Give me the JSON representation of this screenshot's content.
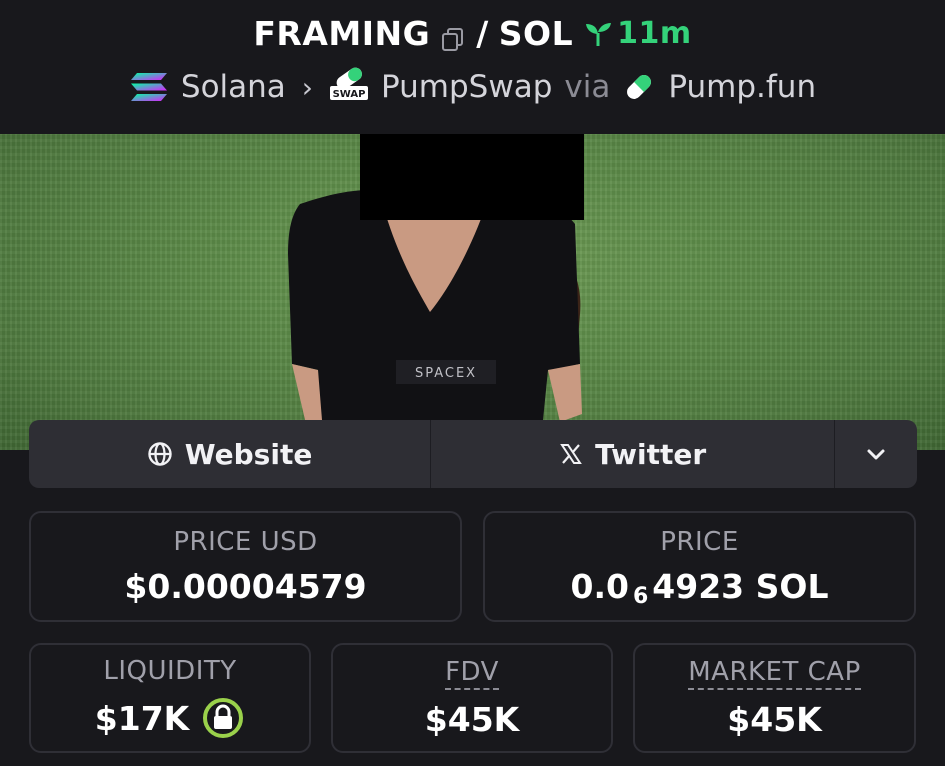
{
  "header": {
    "token": "FRAMING",
    "separator": "/",
    "quote": "SOL",
    "age": "11m",
    "chain": "Solana",
    "dex": "PumpSwap",
    "dex_badge": "SWAP",
    "via": "via",
    "launchpad": "Pump.fun"
  },
  "links": {
    "website": "Website",
    "twitter": "Twitter"
  },
  "stats": {
    "price_usd": {
      "label": "PRICE USD",
      "value": "$0.00004579"
    },
    "price": {
      "label": "PRICE",
      "prefix": "0.0",
      "zeros": "6",
      "suffix": "4923 SOL"
    },
    "liquidity": {
      "label": "LIQUIDITY",
      "value": "$17K"
    },
    "fdv": {
      "label": "FDV",
      "value": "$45K"
    },
    "market_cap": {
      "label": "MARKET CAP",
      "value": "$45K"
    }
  },
  "banner": {
    "shirt_text": "SPACEX"
  },
  "colors": {
    "accent_green": "#34d27a",
    "lock_green": "#9ad14b",
    "background": "#18181c",
    "card_border": "#2f2f36"
  },
  "icons": [
    "copy-icon",
    "sprout-icon",
    "solana-icon",
    "chevron-right-icon",
    "pumpswap-icon",
    "pill-icon",
    "globe-icon",
    "x-icon",
    "chevron-down-icon",
    "lock-icon"
  ]
}
